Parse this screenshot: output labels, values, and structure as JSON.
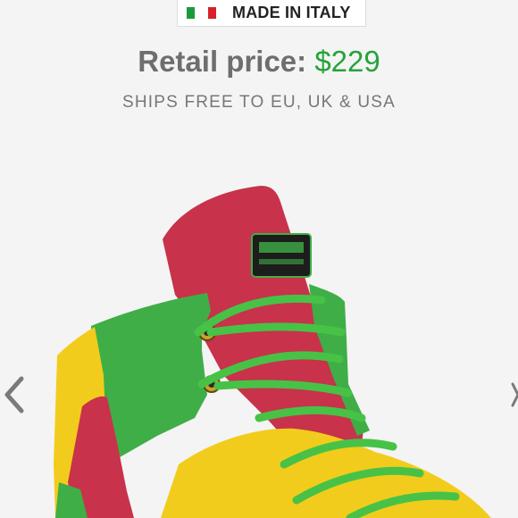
{
  "badge": {
    "label": "MADE IN ITALY",
    "flag_colors": [
      "#1a9b3a",
      "#ffffff",
      "#d6222b"
    ]
  },
  "pricing": {
    "label": "Retail price:",
    "value": "$229",
    "value_color": "#25a339"
  },
  "shipping": {
    "text": "SHIPS FREE TO EU, UK & USA"
  },
  "carousel": {
    "prev_icon": "chevron-left-icon",
    "next_icon": "chevron-right-icon"
  },
  "product": {
    "colors": {
      "red": "#c8324a",
      "green": "#3fae47",
      "yellow": "#f2cc1c",
      "lace": "#47c247"
    }
  }
}
